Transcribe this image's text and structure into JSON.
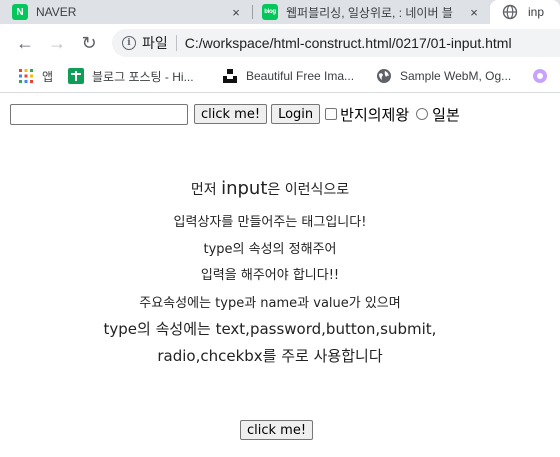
{
  "tabs": [
    {
      "title": "NAVER",
      "favicon_text": "N",
      "favicon_color": "#03c75a",
      "close": "×"
    },
    {
      "title": "웹퍼블리싱, 일상위로, : 네이버 블",
      "favicon_text": "blog",
      "favicon_color": "#03c75a",
      "close": "×"
    },
    {
      "title": "inp",
      "favicon": "globe-icon"
    }
  ],
  "toolbar": {
    "back": "←",
    "forward": "→",
    "reload": "↻",
    "info_symbol": "i",
    "scheme_label": "파일",
    "url": "C:/workspace/html-construct.html/0217/01-input.html"
  },
  "bookmarks": [
    {
      "label": "앱",
      "icon": "apps-grid-icon"
    },
    {
      "label": "블로그 포스팅 - Hi...",
      "icon": "bookmark-plus-icon",
      "icon_color": "#0f9d58"
    },
    {
      "label": "Beautiful Free Ima...",
      "icon": "unsplash-icon"
    },
    {
      "label": "Sample WebM, Og...",
      "icon": "globe-icon"
    }
  ],
  "form": {
    "text_value": "",
    "button_label": "click me!",
    "submit_label": "Login",
    "checkbox_label": "반지의제왕",
    "radio_label": "일본"
  },
  "content": {
    "line1_prefix": "먼저 ",
    "line1_emph": "input",
    "line1_suffix": "은 이런식으로",
    "line2": "입력상자를 만들어주는 태그입니다!",
    "line3": "type의 속성의 정해주어",
    "line4": "입력을 해주어야 합니다!!",
    "line5": "주요속성에는 type과 name과 value가 있으며",
    "line6": "type의 속성에는 text,password,button,submit,",
    "line7": "radio,chcekbx를 주로 사용합니다"
  },
  "bottom_button_label": "click me!",
  "colors": {
    "tabstrip": "#dee1e6",
    "omnibox": "#f1f3f4",
    "naver_green": "#03c75a"
  }
}
